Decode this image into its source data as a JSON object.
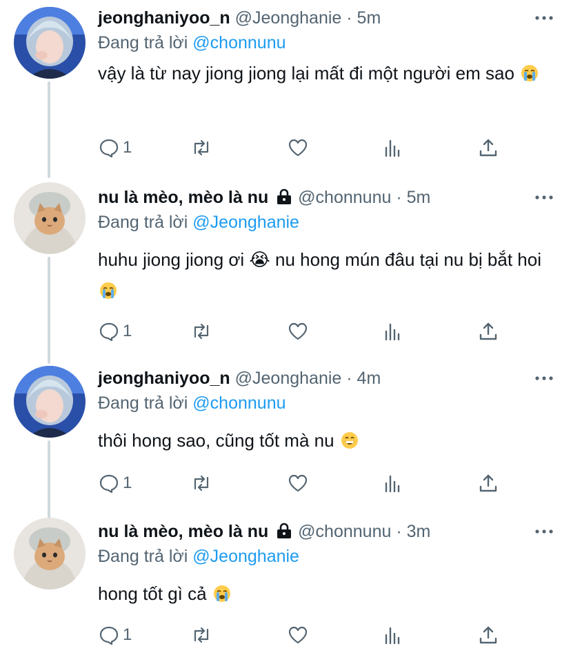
{
  "reply_prefix": "Đang trả lời",
  "dot": "·",
  "tweets": [
    {
      "display_name": "jeonghaniyoo_n",
      "handle": "@Jeonghanie",
      "time": "5m",
      "reply_to": "@chonnunu",
      "text": "vậy là từ nay jiong jiong lại mất đi một người em sao",
      "emoji": "loudly-crying-face",
      "reply_count": "1",
      "locked": false
    },
    {
      "display_name": "nu là mèo, mèo là nu",
      "handle": "@chonnunu",
      "time": "5m",
      "reply_to": "@Jeonghanie",
      "text": "huhu jiong jiong ơi 😭  nu hong mún đâu tại nu bị bắt hoi",
      "emoji": "loudly-crying-face",
      "reply_count": "1",
      "locked": true
    },
    {
      "display_name": "jeonghaniyoo_n",
      "handle": "@Jeonghanie",
      "time": "4m",
      "reply_to": "@chonnunu",
      "text": "thôi hong sao, cũng tốt mà nu",
      "emoji": "grinning-face",
      "reply_count": "1",
      "locked": false
    },
    {
      "display_name": "nu là mèo, mèo là nu",
      "handle": "@chonnunu",
      "time": "3m",
      "reply_to": "@Jeonghanie",
      "text": "hong tốt gì cả",
      "emoji": "loudly-crying-face",
      "reply_count": "1",
      "locked": true
    }
  ],
  "colors": {
    "text": "#0f1419",
    "muted": "#536471",
    "link": "#1d9bf0",
    "thread_line": "#cfd9de"
  }
}
